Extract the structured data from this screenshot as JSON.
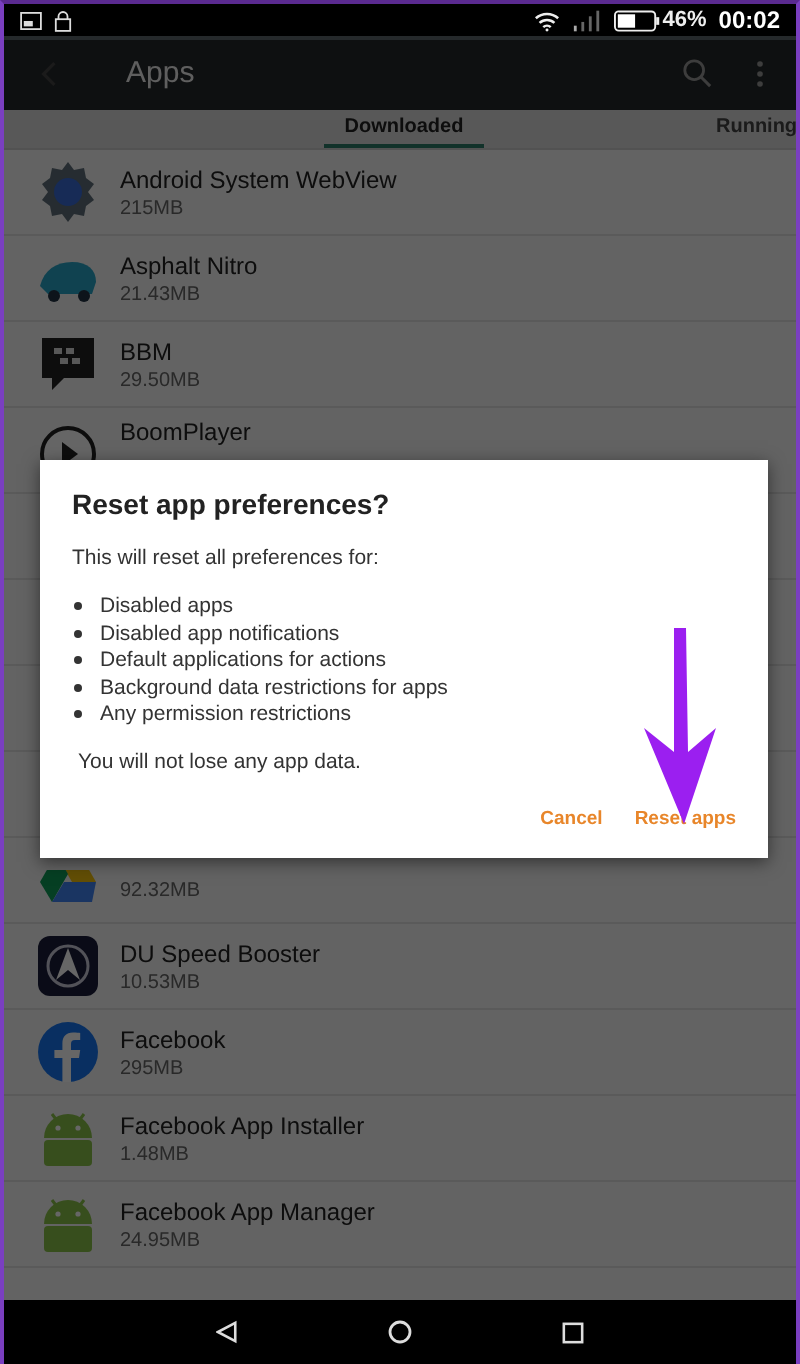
{
  "status_bar": {
    "battery": "46%",
    "time": "00:02"
  },
  "app_bar": {
    "title": "Apps"
  },
  "tabs": [
    {
      "label": "Downloaded",
      "selected": true
    },
    {
      "label": "Running",
      "selected": false
    }
  ],
  "apps": [
    {
      "name": "Android System WebView",
      "size": "215MB"
    },
    {
      "name": "Asphalt Nitro",
      "size": "21.43MB"
    },
    {
      "name": "BBM",
      "size": "29.50MB"
    },
    {
      "name": "BoomPlayer"
    },
    {
      "size": "92.32MB"
    },
    {
      "name": "DU Speed Booster",
      "size": "10.53MB"
    },
    {
      "name": "Facebook",
      "size": "295MB"
    },
    {
      "name": "Facebook App Installer",
      "size": "1.48MB"
    },
    {
      "name": "Facebook App Manager",
      "size": "24.95MB"
    }
  ],
  "dialog": {
    "title": "Reset app preferences?",
    "intro": "This will reset all preferences for:",
    "items": [
      "Disabled apps",
      "Disabled app notifications",
      "Default applications for actions",
      "Background data restrictions for apps",
      "Any permission restrictions"
    ],
    "note": "You will not lose any app data.",
    "buttons": [
      "Cancel",
      "Reset apps"
    ]
  }
}
